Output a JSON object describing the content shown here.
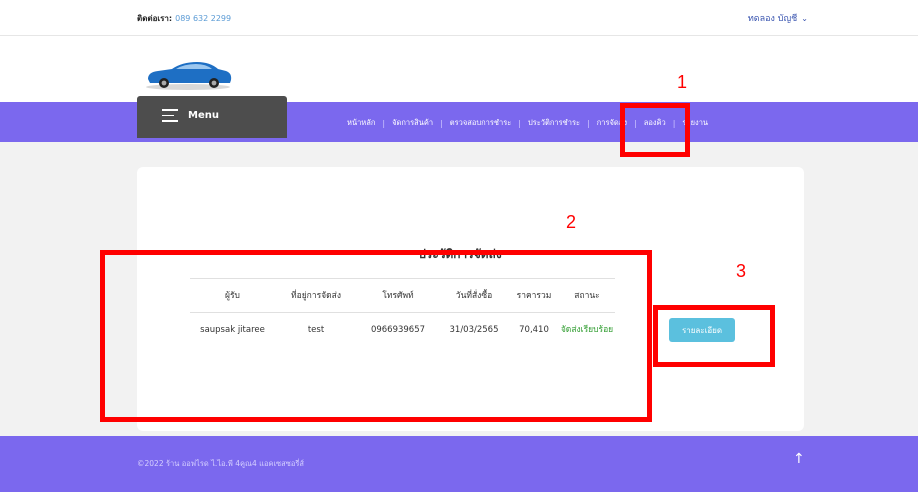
{
  "header": {
    "contact_label": "ติดต่อเรา:",
    "contact_phone": "089 632 2299",
    "account_label": "ทดลอง บัญชี",
    "account_chevron": "⌄"
  },
  "logo": {
    "icon": "car-logo-icon"
  },
  "menu": {
    "label": "Menu",
    "icon": "hamburger-icon"
  },
  "nav": {
    "items": [
      "หน้าหลัก",
      "จัดการสินค้า",
      "ตรวจสอบการชำระ",
      "ประวัติการชำระ",
      "การจัดส่ง",
      "ลองคิว",
      "รายงาน"
    ],
    "separator": "|"
  },
  "annotations": [
    "1",
    "2",
    "3"
  ],
  "content": {
    "title": "ประวัติการจัดส่ง",
    "columns": [
      "ผู้รับ",
      "ที่อยู่การจัดส่ง",
      "โทรศัพท์",
      "วันที่สั่งซื้อ",
      "ราคารวม",
      "สถานะ"
    ],
    "rows": [
      [
        "saupsak jitaree",
        "test",
        "0966939657",
        "31/03/2565",
        "70,410",
        "จัดส่งเรียบร้อย"
      ]
    ],
    "detail_button": "รายละเอียด"
  },
  "footer": {
    "copyright": "©2022 ร้าน ออฟไรด ไ.ไอ.พี 4คูณ4 แอคเซสซอรี่ส์",
    "up_icon": "arrow-up-icon",
    "up_glyph": "↑"
  },
  "colors": {
    "nav_purple": "#7b68ee",
    "menu_dark": "#4d4d4d",
    "annotation_red": "#ff0000",
    "button_teal": "#5bc0de",
    "status_green": "#2e9c2e"
  }
}
